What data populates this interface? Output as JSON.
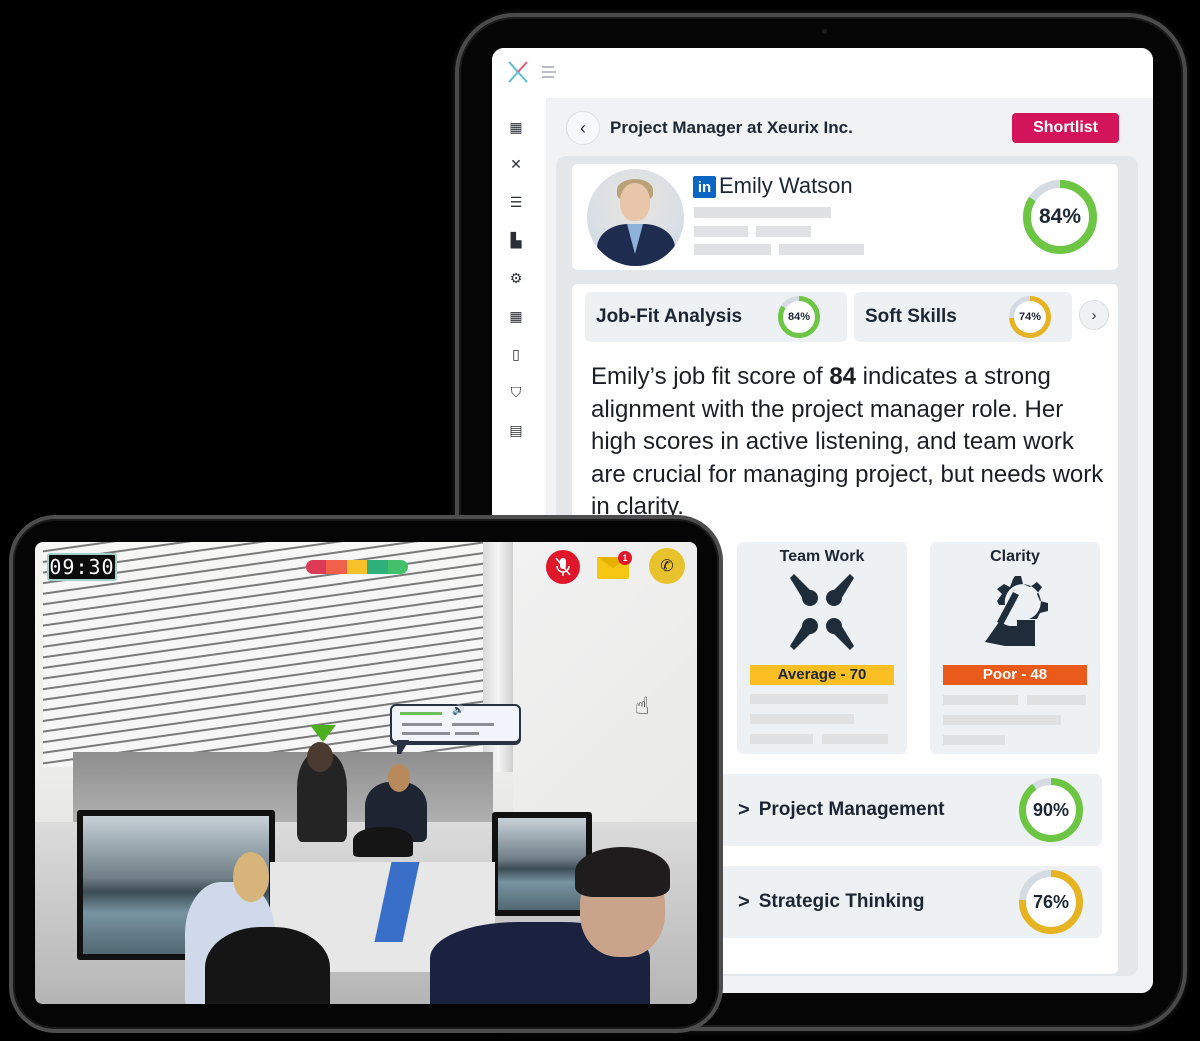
{
  "portrait_app": {
    "brand_icon": "xeurix-x-logo",
    "menu_icon": "hamburger-menu-icon",
    "sidebar": {
      "items": [
        {
          "name": "dashboard",
          "icon": "dashboard-icon",
          "glyph": "▦"
        },
        {
          "name": "skills",
          "icon": "tools-icon",
          "glyph": "✕"
        },
        {
          "name": "candidates",
          "icon": "user-list-icon",
          "glyph": "☰"
        },
        {
          "name": "companies",
          "icon": "building-icon",
          "glyph": "▙"
        },
        {
          "name": "teams",
          "icon": "team-settings-icon",
          "glyph": "⚙"
        },
        {
          "name": "widgets",
          "icon": "grid-icon",
          "glyph": "▦"
        },
        {
          "name": "documents",
          "icon": "file-icon",
          "glyph": "▯"
        },
        {
          "name": "security",
          "icon": "shield-icon",
          "glyph": "⛉"
        },
        {
          "name": "reports",
          "icon": "report-icon",
          "glyph": "▤"
        }
      ]
    },
    "header": {
      "back_glyph": "‹",
      "title": "Project Manager at Xeurix Inc.",
      "shortlist_label": "Shortlist",
      "shortlist_color": "#d4145a"
    },
    "profile": {
      "linkedin_label": "in",
      "name": "Emily Watson",
      "overall_score": 84,
      "overall_label": "84%"
    },
    "tabs": [
      {
        "label": "Job-Fit Analysis",
        "score": 84,
        "score_label": "84%",
        "color": "#6cc644"
      },
      {
        "label": "Soft Skills",
        "score": 74,
        "score_label": "74%",
        "color": "#e6b422"
      }
    ],
    "next_glyph": "›",
    "summary": {
      "before": "Emily’s job fit score of ",
      "bold": "84",
      "after": " indicates a strong alignment with the project manager role. Her high scores in active listening, and team work are crucial for managing project, but needs work in clarity."
    },
    "skills": [
      {
        "title": "Team Work",
        "badge": "Average - 70",
        "badge_color": "#fbbf24",
        "badge_text_color": "#1c2632"
      },
      {
        "title": "Clarity",
        "badge": "Poor - 48",
        "badge_color": "#ea5a1b",
        "badge_text_color": "#ffffff"
      }
    ],
    "competencies": [
      {
        "chevron": ">",
        "label": "Project Management",
        "score": 90,
        "score_label": "90%",
        "color": "#6cc644"
      },
      {
        "chevron": ">",
        "label": "Strategic Thinking",
        "score": 76,
        "score_label": "76%",
        "color": "#e6b422"
      }
    ]
  },
  "simulation": {
    "timer": "09:30",
    "meter_colors": [
      "#dc3b55",
      "#f0604a",
      "#f6c12a",
      "#2fb07a",
      "#44c06a"
    ],
    "mail_badge": "1",
    "call_glyph": "✆",
    "speaker_glyph": "🔊",
    "cursor_glyph": "☝"
  }
}
